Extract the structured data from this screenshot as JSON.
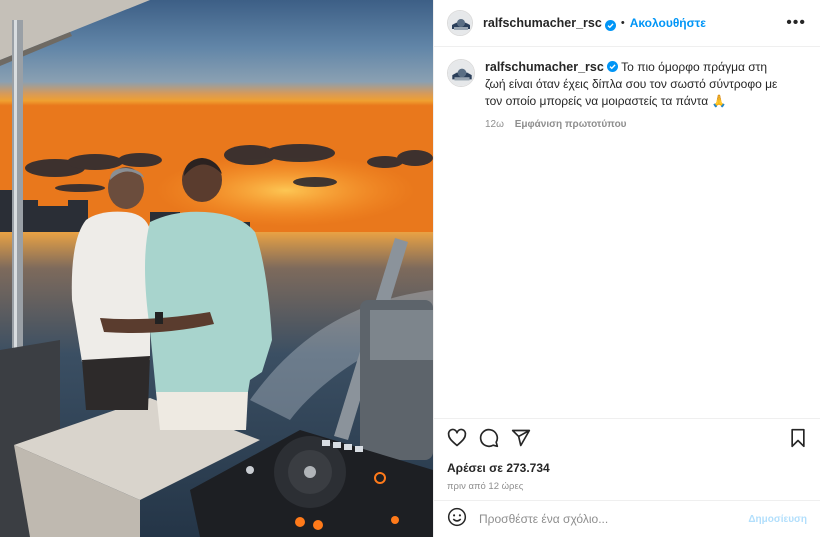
{
  "post": {
    "username": "ralfschumacher_rsc",
    "verified": true,
    "separator": "•",
    "follow_label": "Ακολουθήστε",
    "more_label": "•••",
    "caption": {
      "username": "ralfschumacher_rsc",
      "text": "Το πιο όμορφο πράγμα στη ζωή είναι όταν έχεις δίπλα σου τον σωστό σύντροφο με τον οποίο μπορείς να μοιραστείς τα πάντα 🙏",
      "age": "12ω",
      "see_original": "Εμφάνιση πρωτοτύπου"
    },
    "likes": "Αρέσει σε 273.734",
    "timestamp": "πριν από 12 ώρες",
    "comment_placeholder": "Προσθέστε ένα σχόλιο...",
    "post_button": "Δημοσίευση"
  },
  "icons": {
    "header": [
      "avatar",
      "verified-badge-icon",
      "more-icon"
    ],
    "actions": [
      "heart-icon",
      "comment-icon",
      "share-icon",
      "bookmark-icon"
    ],
    "composer": [
      "emoji-icon"
    ]
  },
  "colors": {
    "accent": "#0095f6",
    "post_button_disabled": "#b2dffc",
    "muted": "#8e8e8e",
    "border": "#efefef"
  }
}
